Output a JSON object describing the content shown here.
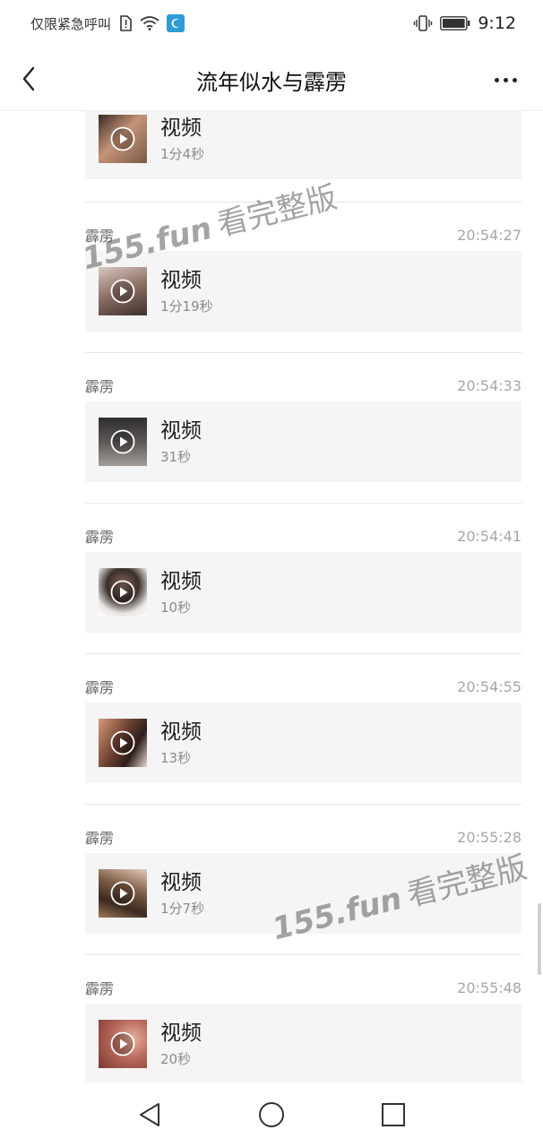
{
  "status_bar": {
    "carrier_text": "仅限紧急呼叫",
    "time": "9:12"
  },
  "header": {
    "title": "流年似水与霹雳"
  },
  "messages": [
    {
      "sender": "",
      "time": "",
      "title": "视频",
      "duration": "1分4秒",
      "thumb_color": "#8a6a54"
    },
    {
      "sender": "霹雳",
      "time": "20:54:27",
      "title": "视频",
      "duration": "1分19秒",
      "thumb_color": "#9a8278"
    },
    {
      "sender": "霹雳",
      "time": "20:54:33",
      "title": "视频",
      "duration": "31秒",
      "thumb_color": "#4a4746"
    },
    {
      "sender": "霹雳",
      "time": "20:54:41",
      "title": "视频",
      "duration": "10秒",
      "thumb_color": "#c7c2bd"
    },
    {
      "sender": "霹雳",
      "time": "20:54:55",
      "title": "视频",
      "duration": "13秒",
      "thumb_color": "#7a4e3e"
    },
    {
      "sender": "霹雳",
      "time": "20:55:28",
      "title": "视频",
      "duration": "1分7秒",
      "thumb_color": "#5b4536"
    },
    {
      "sender": "霹雳",
      "time": "20:55:48",
      "title": "视频",
      "duration": "20秒",
      "thumb_color": "#b0685a"
    }
  ],
  "watermarks": [
    {
      "brand": "155.fun",
      "text": "看完整版"
    },
    {
      "brand": "155.fun",
      "text": "看完整版"
    }
  ],
  "icons": {
    "back": "back-arrow-icon",
    "more": "more-dots-icon",
    "play": "play-icon",
    "nav_back": "nav-back-icon",
    "nav_home": "nav-home-icon",
    "nav_recents": "nav-recents-icon"
  },
  "colors": {
    "card_background": "#f5f5f5",
    "timestamp": "#a6a6a6",
    "wifi_badge": "#2d9bd6"
  }
}
